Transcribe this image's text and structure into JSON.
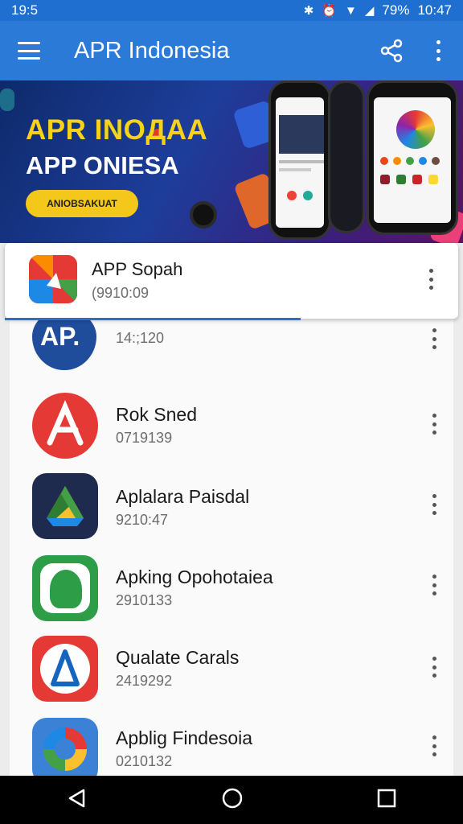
{
  "status": {
    "time_left": "19:5",
    "battery": "79%",
    "time_right": "10:47"
  },
  "appbar": {
    "title": "APR Indonesia"
  },
  "banner": {
    "line1": "APR INOДAA",
    "line2": "APP ONIESA",
    "button": "ANIOBSAKUAT"
  },
  "selected": {
    "name": "APP Sopah",
    "sub": "(9910:09"
  },
  "items": [
    {
      "name": "",
      "sub": "14:;120"
    },
    {
      "name": "Rok Sned",
      "sub": "0719139"
    },
    {
      "name": "Aplalara Paisdal",
      "sub": "9210:47"
    },
    {
      "name": "Apking Opohotaiea",
      "sub": "2910133"
    },
    {
      "name": "Qualate Carals",
      "sub": "2419292"
    },
    {
      "name": "Apblig Findesoia",
      "sub": "0210132"
    }
  ],
  "icons": {
    "ap_icon_text": "AP.",
    "colors": {
      "primary": "#2b7ad8",
      "accent": "#f3c81b",
      "red": "#e53935"
    }
  }
}
